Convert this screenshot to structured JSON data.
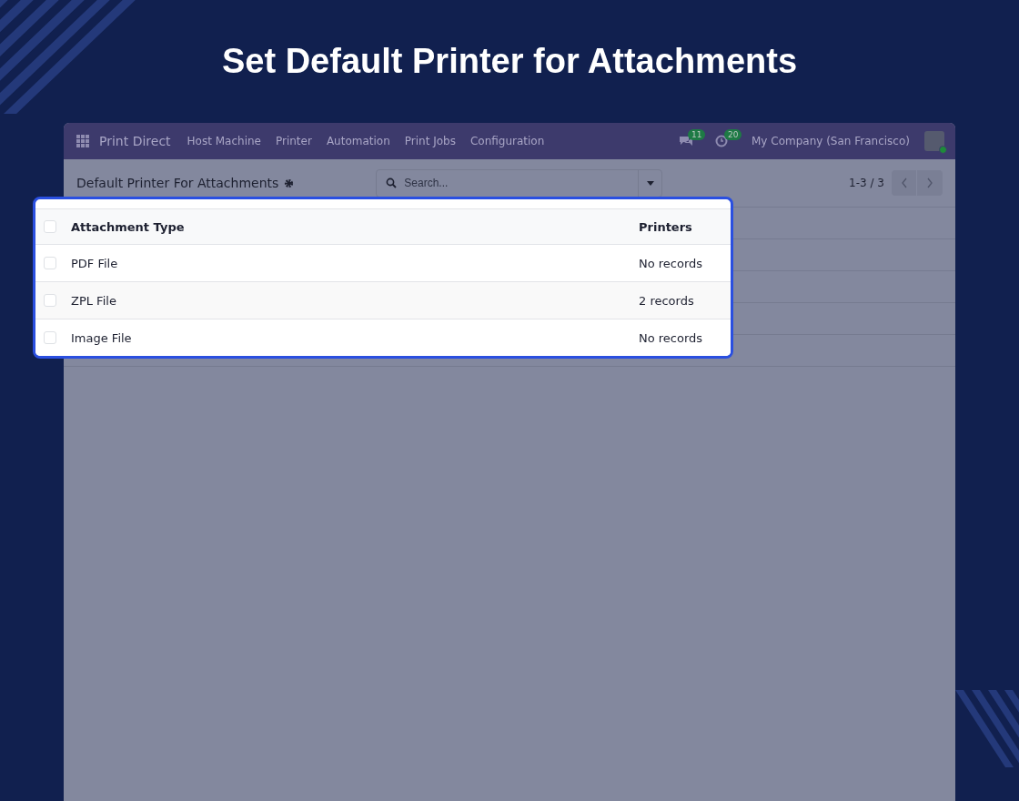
{
  "heading": "Set Default Printer for Attachments",
  "navbar": {
    "app_name": "Print Direct",
    "menu": [
      "Host Machine",
      "Printer",
      "Automation",
      "Print Jobs",
      "Configuration"
    ],
    "messages_badge": "11",
    "activities_badge": "20",
    "company": "My Company (San Francisco)"
  },
  "control_panel": {
    "title": "Default Printer For Attachments",
    "search": {
      "placeholder": "Search..."
    },
    "pager": "1-3 / 3"
  },
  "table": {
    "select_all_checked": false,
    "columns": [
      "Attachment Type",
      "Printers"
    ],
    "rows": [
      {
        "attachment_type": "PDF File",
        "printers": "No records",
        "checked": false
      },
      {
        "attachment_type": "ZPL File",
        "printers": "2 records",
        "checked": false
      },
      {
        "attachment_type": "Image File",
        "printers": "No records",
        "checked": false
      }
    ]
  }
}
